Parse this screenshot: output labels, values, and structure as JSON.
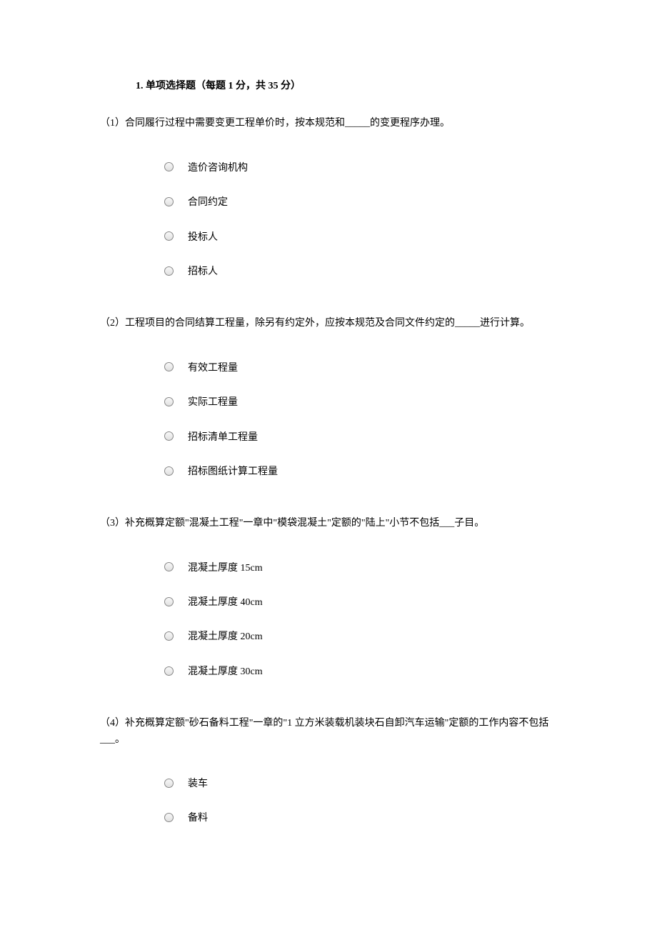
{
  "section": {
    "number": "1.",
    "title": "单项选择题（每题 1 分，共 35 分）"
  },
  "questions": [
    {
      "number": "（1）",
      "text": "合同履行过程中需要变更工程单价时，按本规范和_____的变更程序办理。",
      "options": [
        "造价咨询机构",
        "合同约定",
        "投标人",
        "招标人"
      ]
    },
    {
      "number": "（2）",
      "text": "工程项目的合同结算工程量，除另有约定外，应按本规范及合同文件约定的_____进行计算。",
      "options": [
        "有效工程量",
        "实际工程量",
        "招标清单工程量",
        "招标图纸计算工程量"
      ]
    },
    {
      "number": "（3）",
      "text": "补充概算定额\"混凝土工程\"一章中\"模袋混凝土\"定额的\"陆上\"小节不包括___子目。",
      "options": [
        "混凝土厚度 15cm",
        "混凝土厚度 40cm",
        "混凝土厚度 20cm",
        "混凝土厚度 30cm"
      ]
    },
    {
      "number": "（4）",
      "text": "补充概算定额\"砂石备料工程\"一章的\"1 立方米装载机装块石自卸汽车运输\"定额的工作内容不包括___。",
      "options": [
        "装车",
        "备料"
      ]
    }
  ]
}
